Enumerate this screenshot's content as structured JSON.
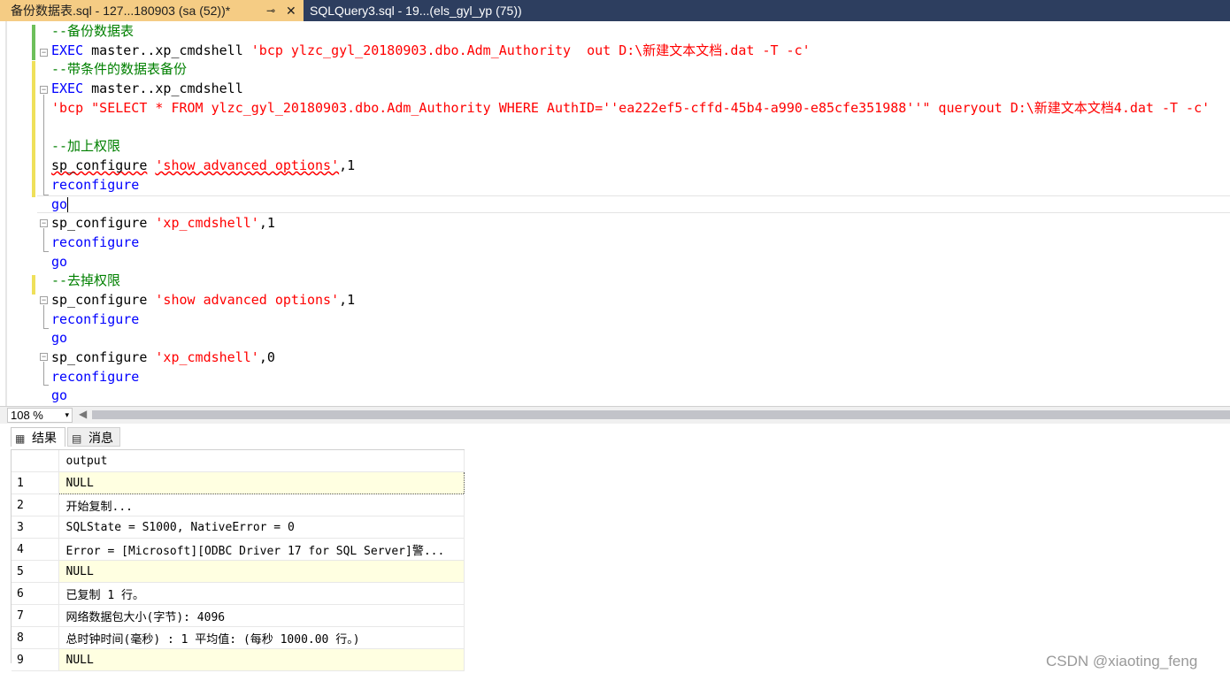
{
  "tabs": [
    {
      "label": "备份数据表.sql - 127...180903 (sa (52))*",
      "pin": "⊸",
      "close": "✕"
    },
    {
      "label": "SQLQuery3.sql - 19...(els_gyl_yp (75))"
    }
  ],
  "code_lines": [
    [
      {
        "t": "--备份数据表",
        "c": "cm"
      }
    ],
    [
      {
        "t": "EXEC",
        "c": "kw"
      },
      {
        "t": " master..xp_cmdshell ",
        "c": "fn"
      },
      {
        "t": "'bcp ylzc_gyl_20180903.dbo.Adm_Authority  out D:\\新建文本文档.dat -T -c'",
        "c": "st"
      }
    ],
    [
      {
        "t": "--带条件的数据表备份",
        "c": "cm"
      }
    ],
    [
      {
        "t": "EXEC",
        "c": "kw"
      },
      {
        "t": " master..xp_cmdshell",
        "c": "fn"
      }
    ],
    [
      {
        "t": "'bcp \"SELECT * FROM ylzc_gyl_20180903.dbo.Adm_Authority WHERE AuthID=''ea222ef5-cffd-45b4-a990-e85cfe351988''\" queryout D:\\新建文本文档4.dat -T -c'",
        "c": "st"
      }
    ],
    [],
    [
      {
        "t": "--加上权限",
        "c": "cm"
      }
    ],
    [
      {
        "t": "sp_configure",
        "c": "fn sq"
      },
      {
        "t": " ",
        "c": "fn"
      },
      {
        "t": "'show advanced options'",
        "c": "st sq"
      },
      {
        "t": ",1",
        "c": "fn"
      }
    ],
    [
      {
        "t": "reconfigure",
        "c": "kw"
      }
    ],
    [
      {
        "t": "go",
        "c": "kw"
      }
    ],
    [
      {
        "t": "sp_configure ",
        "c": "fn"
      },
      {
        "t": "'xp_cmdshell'",
        "c": "st"
      },
      {
        "t": ",1",
        "c": "fn"
      }
    ],
    [
      {
        "t": "reconfigure",
        "c": "kw"
      }
    ],
    [
      {
        "t": "go",
        "c": "kw"
      }
    ],
    [
      {
        "t": "--去掉权限",
        "c": "cm"
      }
    ],
    [
      {
        "t": "sp_configure ",
        "c": "fn"
      },
      {
        "t": "'show advanced options'",
        "c": "st"
      },
      {
        "t": ",1",
        "c": "fn"
      }
    ],
    [
      {
        "t": "reconfigure",
        "c": "kw"
      }
    ],
    [
      {
        "t": "go",
        "c": "kw"
      }
    ],
    [
      {
        "t": "sp_configure ",
        "c": "fn"
      },
      {
        "t": "'xp_cmdshell'",
        "c": "st"
      },
      {
        "t": ",0",
        "c": "fn"
      }
    ],
    [
      {
        "t": "reconfigure",
        "c": "kw"
      }
    ],
    [
      {
        "t": "go",
        "c": "kw"
      }
    ]
  ],
  "zoom": {
    "value": "108 %",
    "dropdown_icon": "▾",
    "scroll_left_icon": "◀"
  },
  "result_tabs": [
    {
      "label": "结果",
      "icon": "grid-icon"
    },
    {
      "label": "消息",
      "icon": "message-icon"
    }
  ],
  "grid": {
    "column": "output",
    "rows": [
      {
        "n": "1",
        "v": "NULL",
        "null": true,
        "selected": true
      },
      {
        "n": "2",
        "v": "开始复制..."
      },
      {
        "n": "3",
        "v": "SQLState = S1000, NativeError = 0"
      },
      {
        "n": "4",
        "v": "Error = [Microsoft][ODBC Driver 17 for SQL Server]警..."
      },
      {
        "n": "5",
        "v": "NULL",
        "null": true
      },
      {
        "n": "6",
        "v": "已复制 1 行。"
      },
      {
        "n": "7",
        "v": "网络数据包大小(字节): 4096"
      },
      {
        "n": "8",
        "v": "总时钟时间(毫秒)     : 1      平均值: (每秒 1000.00 行。)"
      },
      {
        "n": "9",
        "v": "NULL",
        "null": true
      }
    ]
  },
  "watermark": "CSDN @xiaoting_feng",
  "colors": {
    "tab_active": "#f5cc84",
    "tab_bar": "#2d3e5f",
    "keyword": "#0000ff",
    "string": "#ff0000",
    "comment": "#008000",
    "null_cell": "#ffffe1"
  }
}
